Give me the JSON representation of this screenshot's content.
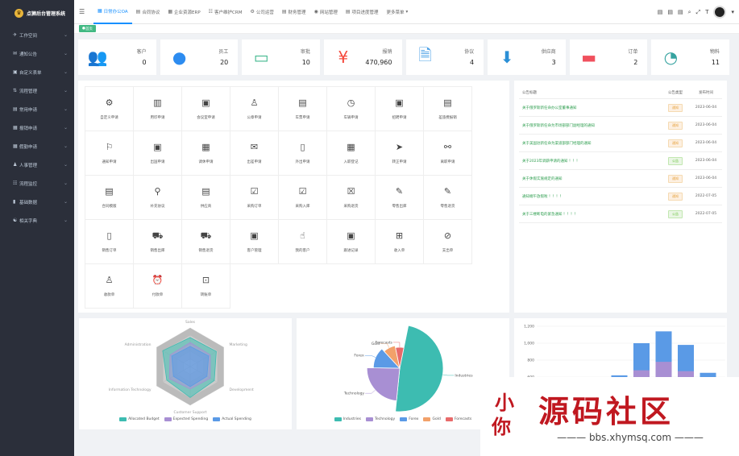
{
  "app": {
    "title": "点狮后台管理系统"
  },
  "sidebar": {
    "items": [
      {
        "label": "工作空间"
      },
      {
        "label": "通知公告"
      },
      {
        "label": "自定义表单"
      },
      {
        "label": "流程管理"
      },
      {
        "label": "常用申请"
      },
      {
        "label": "报销申请"
      },
      {
        "label": "假勤申请"
      },
      {
        "label": "人事管理"
      },
      {
        "label": "流程监控"
      },
      {
        "label": "基础数据"
      },
      {
        "label": "相关字典"
      }
    ]
  },
  "topnav": {
    "tabs": [
      {
        "label": "日常办公OA",
        "active": true
      },
      {
        "label": "合同协议"
      },
      {
        "label": "企业资源ERP"
      },
      {
        "label": "客户维护CRM"
      },
      {
        "label": "公司运营"
      },
      {
        "label": "财务管理"
      },
      {
        "label": "网站管理"
      },
      {
        "label": "项目进度管理"
      },
      {
        "label": "更多菜单"
      }
    ]
  },
  "tagsbar": {
    "home": "首页"
  },
  "stats": [
    {
      "label": "客户",
      "value": "0",
      "color": "#43b98f"
    },
    {
      "label": "员工",
      "value": "20",
      "color": "#2d8cf0"
    },
    {
      "label": "审批",
      "value": "10",
      "color": "#43b98f"
    },
    {
      "label": "报销",
      "value": "470,960",
      "color": "#f5483b"
    },
    {
      "label": "协议",
      "value": "4",
      "color": "#4aa0e6"
    },
    {
      "label": "供应商",
      "value": "3",
      "color": "#2b8fd6"
    },
    {
      "label": "订单",
      "value": "2",
      "color": "#f0505d"
    },
    {
      "label": "物料",
      "value": "11",
      "color": "#36a3a0"
    }
  ],
  "apps": [
    {
      "label": "自定义申请"
    },
    {
      "label": "用印申请"
    },
    {
      "label": "会议室申请"
    },
    {
      "label": "公章申请"
    },
    {
      "label": "车票申请"
    },
    {
      "label": "车辆申请"
    },
    {
      "label": "招聘申请"
    },
    {
      "label": "差旅费报销"
    },
    {
      "label": "通知申请"
    },
    {
      "label": "出国申请"
    },
    {
      "label": "调休申请"
    },
    {
      "label": "出差申请"
    },
    {
      "label": "外出申请"
    },
    {
      "label": "入职登记"
    },
    {
      "label": "转正申请"
    },
    {
      "label": "离职申请"
    },
    {
      "label": "合同模版"
    },
    {
      "label": "补充协议"
    },
    {
      "label": "供应商"
    },
    {
      "label": "采购订单"
    },
    {
      "label": "采购入库"
    },
    {
      "label": "采购退货"
    },
    {
      "label": "零售出库"
    },
    {
      "label": "零售退货"
    },
    {
      "label": "销售订单"
    },
    {
      "label": "销售出库"
    },
    {
      "label": "销售退货"
    },
    {
      "label": "客户管理"
    },
    {
      "label": "我的客户"
    },
    {
      "label": "跟进记录"
    },
    {
      "label": "收入单"
    },
    {
      "label": "支出单"
    },
    {
      "label": "收款单"
    },
    {
      "label": "付款单"
    },
    {
      "label": "转账单"
    }
  ],
  "notices": {
    "headers": [
      "公告标题",
      "公告类型",
      "发布时间"
    ],
    "rows": [
      {
        "title": "关于俄罗斯新任命办公室董事通知",
        "type": "通知",
        "date": "2023-06-04"
      },
      {
        "title": "关于俄罗斯新任命为市场部部门副经理的通知",
        "type": "通知",
        "date": "2023-06-04"
      },
      {
        "title": "关于美国驻新任命为渠道部部门经理的通知",
        "type": "通知",
        "date": "2023-06-04"
      },
      {
        "title": "关于2023年调薪申请的通知 ！！！",
        "type": "公告",
        "date": "2023-06-04"
      },
      {
        "title": "关于休假实施规定的通知",
        "type": "通知",
        "date": "2023-06-04"
      },
      {
        "title": "通知端午放假啦 ！！！！",
        "type": "通知",
        "date": "2022-07-05"
      },
      {
        "title": "关于三楼断电的紧急通知 ！！！！",
        "type": "公告",
        "date": "2022-07-05"
      }
    ]
  },
  "chart_data": [
    {
      "type": "radar",
      "indicators": [
        "Sales",
        "Marketing",
        "Development",
        "Customer Support",
        "Information Technology",
        "Administration"
      ],
      "series": [
        {
          "name": "Allocated Budget",
          "color": "#3dbcb1"
        },
        {
          "name": "Expected Spending",
          "color": "#a88fd3"
        },
        {
          "name": "Actual Spending",
          "color": "#5a9ae6"
        }
      ]
    },
    {
      "type": "pie",
      "rose": true,
      "categories": [
        "Industries",
        "Technology",
        "Forex",
        "Gold",
        "Forecasts"
      ],
      "values": [
        45,
        22,
        12,
        8,
        6
      ],
      "colors": [
        "#3dbcb1",
        "#a88fd3",
        "#5a9ae6",
        "#f2a16a",
        "#e86a6a"
      ]
    },
    {
      "type": "bar",
      "stacked": true,
      "ylabels": [
        "1,200",
        "1,000",
        "800",
        "600"
      ],
      "ylim": [
        600,
        1200
      ],
      "colors": [
        "#5a9ae6",
        "#a88fd3"
      ]
    }
  ],
  "watermark": {
    "text": "源码社区",
    "seal": "小 你",
    "url": "bbs.xhymsq.com"
  }
}
